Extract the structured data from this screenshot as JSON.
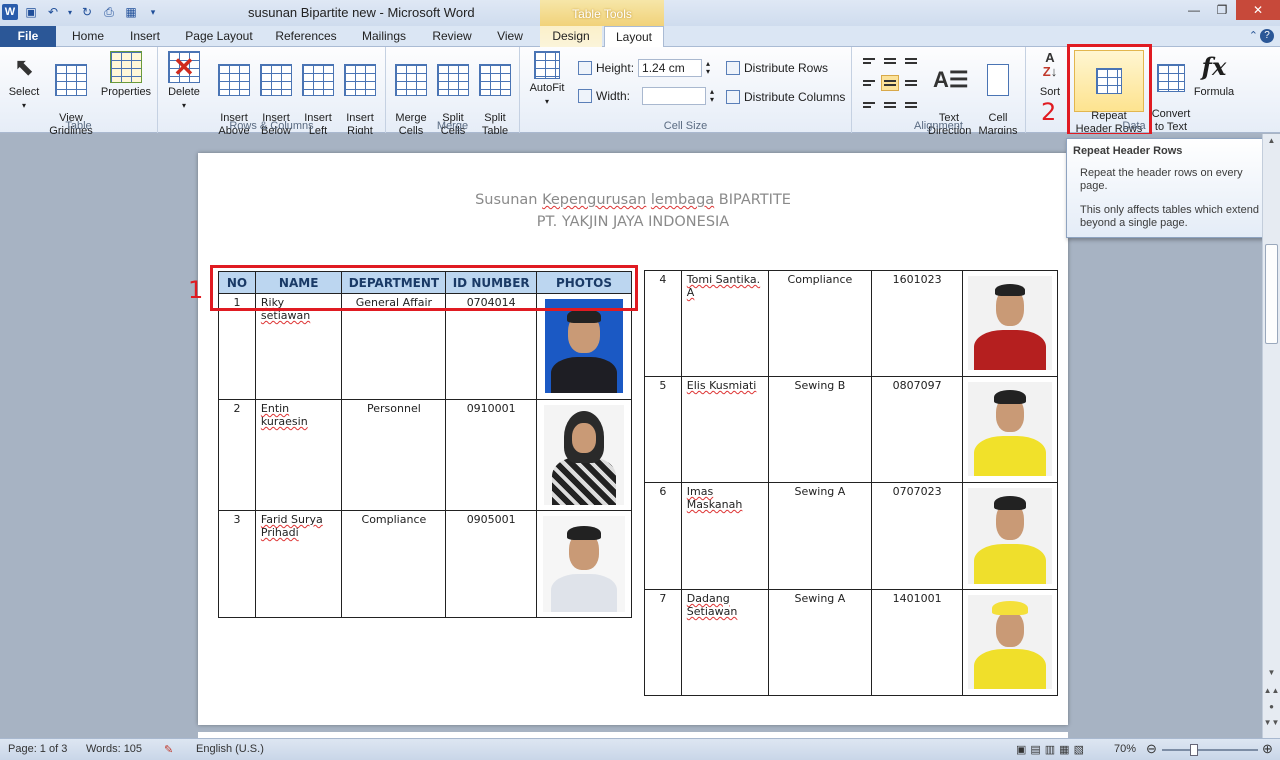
{
  "window": {
    "title": "susunan Bipartite new  -  Microsoft Word",
    "context_tab_group": "Table Tools"
  },
  "tabs": [
    "File",
    "Home",
    "Insert",
    "Page Layout",
    "References",
    "Mailings",
    "Review",
    "View",
    "Design",
    "Layout"
  ],
  "active_tab": "Layout",
  "ribbon": {
    "table_group": {
      "label": "Table",
      "select": "Select",
      "view_gridlines": "View\nGridlines",
      "properties": "Properties"
    },
    "rows_columns_group": {
      "label": "Rows & Columns",
      "delete": "Delete",
      "insert_above": "Insert\nAbove",
      "insert_below": "Insert\nBelow",
      "insert_left": "Insert\nLeft",
      "insert_right": "Insert\nRight"
    },
    "merge_group": {
      "label": "Merge",
      "merge_cells": "Merge\nCells",
      "split_cells": "Split\nCells",
      "split_table": "Split\nTable"
    },
    "cell_size_group": {
      "label": "Cell Size",
      "autofit": "AutoFit",
      "height_label": "Height:",
      "height_value": "1.24 cm",
      "width_label": "Width:",
      "width_value": "",
      "distribute_rows": "Distribute Rows",
      "distribute_columns": "Distribute Columns"
    },
    "alignment_group": {
      "label": "Alignment",
      "text_direction": "Text\nDirection",
      "cell_margins": "Cell\nMargins"
    },
    "data_group": {
      "label": "Data",
      "sort": "Sort",
      "repeat_header_rows": "Repeat\nHeader Rows",
      "convert_to_text": "Convert\nto Text",
      "formula": "Formula"
    }
  },
  "annotations": {
    "marker1": "1",
    "marker2": "2"
  },
  "tooltip": {
    "title": "Repeat Header Rows",
    "line1": "Repeat the header rows on every page.",
    "line2": "This only affects tables which extend beyond a single page."
  },
  "document": {
    "title_line1_a": "Susunan ",
    "title_line1_b": "Kepengurusan",
    "title_line1_c": " ",
    "title_line1_d": "lembaga",
    "title_line1_e": " BIPARTITE",
    "title_line2": "PT. YAKJIN JAYA INDONESIA",
    "headers": [
      "NO",
      "NAME",
      "DEPARTMENT",
      "ID NUMBER",
      "PHOTOS"
    ],
    "left_rows": [
      {
        "no": "1",
        "name": "Riky setiawan",
        "dept": "General Affair",
        "id": "0704014"
      },
      {
        "no": "2",
        "name": "Entin kuraesin",
        "dept": "Personnel",
        "id": "0910001"
      },
      {
        "no": "3",
        "name": "Farid Surya Prihadi",
        "dept": "Compliance",
        "id": "0905001"
      }
    ],
    "right_rows": [
      {
        "no": "4",
        "name": "Tomi Santika. A",
        "dept": "Compliance",
        "id": "1601023"
      },
      {
        "no": "5",
        "name": "Elis Kusmiati",
        "dept": "Sewing B",
        "id": "0807097"
      },
      {
        "no": "6",
        "name": "Imas Maskanah",
        "dept": "Sewing A",
        "id": "0707023"
      },
      {
        "no": "7",
        "name": "Dadang Setiawan",
        "dept": "Sewing A",
        "id": "1401001"
      }
    ]
  },
  "status": {
    "page": "Page: 1 of 3",
    "words": "Words: 105",
    "language": "English (U.S.)",
    "zoom": "70%"
  },
  "colors": {
    "accent": "#2b5797",
    "highlight": "#e01b22",
    "header_fill": "#bcd6f0"
  }
}
